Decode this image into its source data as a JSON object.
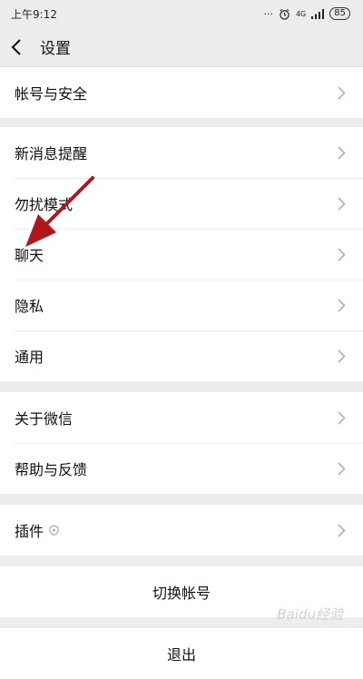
{
  "status": {
    "time": "上午9:12",
    "network": "4G",
    "battery": "85"
  },
  "header": {
    "title": "设置"
  },
  "groups": [
    {
      "items": [
        "帐号与安全"
      ]
    },
    {
      "items": [
        "新消息提醒",
        "勿扰模式",
        "聊天",
        "隐私",
        "通用"
      ]
    },
    {
      "items": [
        "关于微信",
        "帮助与反馈"
      ]
    },
    {
      "items": [
        "插件"
      ]
    }
  ],
  "actions": {
    "switch_account": "切换帐号",
    "logout": "退出"
  },
  "annotation": {
    "arrow_color": "#b3151c"
  },
  "watermark": "Baidu经验"
}
